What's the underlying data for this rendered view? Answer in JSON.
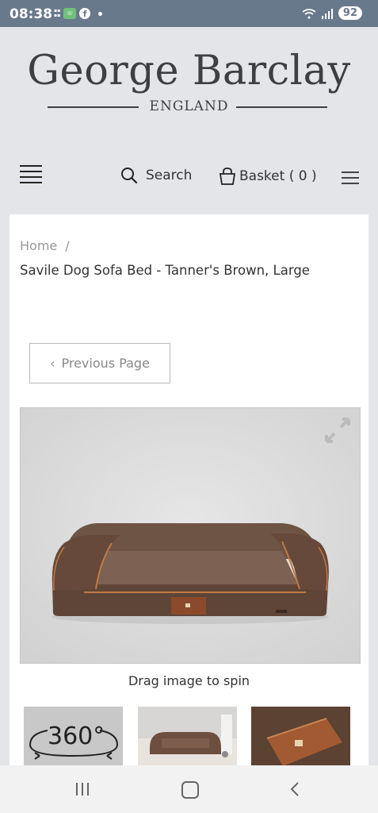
{
  "status_bar": {
    "time": "08:38",
    "battery": "92",
    "app_icons": [
      "temu-icon",
      "phone-app-icon",
      "facebook-icon",
      "notification-dot-icon"
    ]
  },
  "logo": {
    "main": "George Barclay",
    "sub": "ENGLAND"
  },
  "nav": {
    "search_label": "Search",
    "basket_label": "Basket ( 0 )"
  },
  "breadcrumb": {
    "home": "Home",
    "separator": "/"
  },
  "product": {
    "title": "Savile Dog Sofa Bed - Tanner's Brown, Large"
  },
  "prev_page": {
    "label": "Previous Page",
    "chevron": "‹"
  },
  "viewer": {
    "caption": "Drag image to spin"
  },
  "thumbnails": [
    {
      "label": "360°"
    },
    {
      "label": ""
    },
    {
      "label": ""
    }
  ],
  "colors": {
    "status_bar": "#69798c",
    "page_bg": "#e3e5e9",
    "brown": "#6a5243",
    "piping": "#c0773f"
  }
}
